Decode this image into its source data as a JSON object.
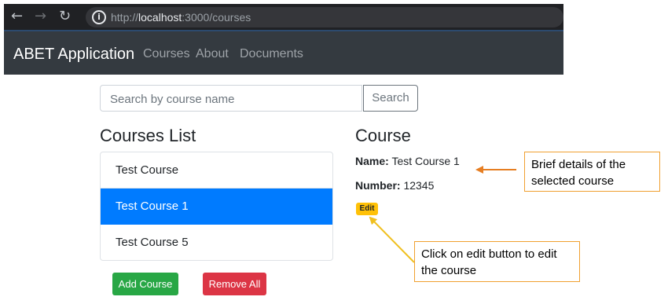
{
  "browser": {
    "url_scheme": "http://",
    "url_host": "localhost",
    "url_path": ":3000/courses"
  },
  "navbar": {
    "brand": "ABET Application",
    "links": [
      "Courses",
      "About",
      "Documents"
    ]
  },
  "search": {
    "placeholder": "Search by course name",
    "button_label": "Search"
  },
  "courses_list": {
    "heading": "Courses List",
    "items": [
      {
        "label": "Test Course",
        "active": false
      },
      {
        "label": "Test Course 1",
        "active": true
      },
      {
        "label": "Test Course 5",
        "active": false
      }
    ],
    "add_label": "Add Course",
    "remove_label": "Remove All"
  },
  "course": {
    "heading": "Course",
    "name_label": "Name:",
    "name_value": "Test Course 1",
    "number_label": "Number:",
    "number_value": "12345",
    "edit_label": "Edit"
  },
  "annotations": {
    "details_callout": "Brief details of the selected course",
    "edit_callout": "Click on edit button to edit the course"
  },
  "colors": {
    "primary": "#007bff",
    "success": "#28a745",
    "danger": "#dc3545",
    "warning": "#ffc107",
    "navbar": "#343a40",
    "callout_border": "#f0a030",
    "arrow_orange": "#e67e22"
  }
}
